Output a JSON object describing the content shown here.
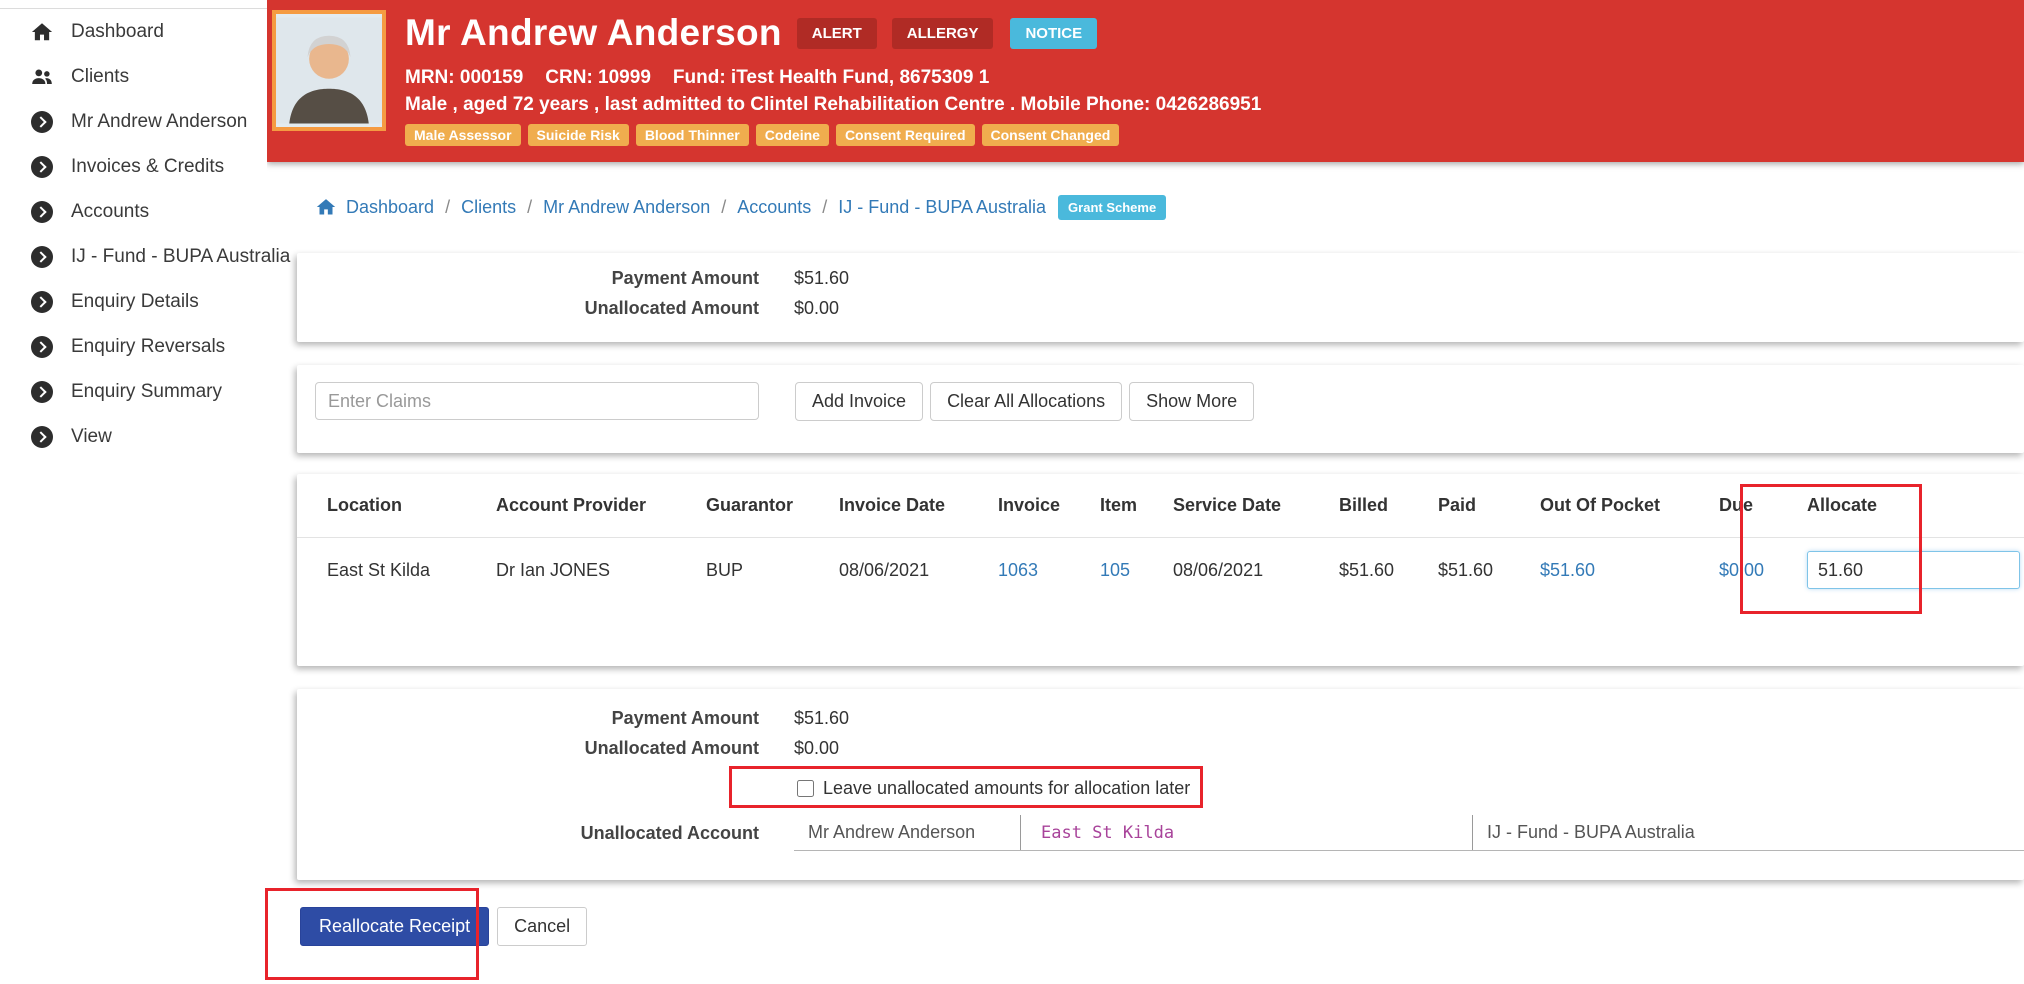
{
  "colors": {
    "header_red": "#d5352f",
    "badge_dark_red": "#b02b25",
    "badge_cyan": "#4ab9dc",
    "tag_orange": "#f0ad4e",
    "link_blue": "#337ab7",
    "primary_blue": "#2e4ca5",
    "annotation_red": "#e8232b",
    "magenta": "#a8439a",
    "avatar_orange": "#f59b42"
  },
  "sidebar": {
    "items": [
      {
        "label": "Dashboard",
        "icon": "home-icon"
      },
      {
        "label": "Clients",
        "icon": "users-icon"
      },
      {
        "label": "Mr Andrew Anderson",
        "icon": "chevron-circle-icon"
      },
      {
        "label": "Invoices & Credits",
        "icon": "chevron-circle-icon"
      },
      {
        "label": "Accounts",
        "icon": "chevron-circle-icon"
      },
      {
        "label": "IJ - Fund - BUPA Australia",
        "icon": "chevron-circle-icon"
      },
      {
        "label": "Enquiry Details",
        "icon": "chevron-circle-icon"
      },
      {
        "label": "Enquiry Reversals",
        "icon": "chevron-circle-icon"
      },
      {
        "label": "Enquiry Summary",
        "icon": "chevron-circle-icon"
      },
      {
        "label": "View",
        "icon": "chevron-circle-icon"
      }
    ]
  },
  "header": {
    "patient_name": "Mr Andrew Anderson",
    "badges": [
      {
        "label": "ALERT"
      },
      {
        "label": "ALLERGY"
      },
      {
        "label": "NOTICE"
      }
    ],
    "identifier_parts": [
      "MRN: 000159",
      "CRN: 10999",
      "Fund: iTest Health Fund, 8675309 1"
    ],
    "demographics": "Male , aged 72 years , last admitted to Clintel Rehabilitation Centre . Mobile Phone: 0426286951",
    "alert_tags": [
      "Male Assessor",
      "Suicide Risk",
      "Blood Thinner",
      "Codeine",
      "Consent Required",
      "Consent Changed"
    ]
  },
  "breadcrumb": {
    "separator": "/",
    "items": [
      "Dashboard",
      "Clients",
      "Mr Andrew Anderson",
      "Accounts",
      "IJ - Fund - BUPA Australia"
    ],
    "badge": "Grant Scheme"
  },
  "payment_summary_top": {
    "payment_amount_label": "Payment Amount",
    "payment_amount": "$51.60",
    "unallocated_amount_label": "Unallocated Amount",
    "unallocated_amount": "$0.00"
  },
  "claims_toolbar": {
    "search_placeholder": "Enter Claims",
    "buttons": [
      "Add Invoice",
      "Clear All Allocations",
      "Show More"
    ]
  },
  "invoice_table": {
    "columns": [
      "Location",
      "Account Provider",
      "Guarantor",
      "Invoice Date",
      "Invoice",
      "Item",
      "Service Date",
      "Billed",
      "Paid",
      "Out Of Pocket",
      "Due",
      "Allocate"
    ],
    "rows": [
      {
        "location": "East St Kilda",
        "account_provider": "Dr Ian JONES",
        "guarantor": "BUP",
        "invoice_date": "08/06/2021",
        "invoice": "1063",
        "item": "105",
        "service_date": "08/06/2021",
        "billed": "$51.60",
        "paid": "$51.60",
        "out_of_pocket": "$51.60",
        "due": "$0.00",
        "allocate": "51.60"
      }
    ]
  },
  "payment_summary_bottom": {
    "payment_amount_label": "Payment Amount",
    "payment_amount": "$51.60",
    "unallocated_amount_label": "Unallocated Amount",
    "unallocated_amount": "$0.00",
    "checkbox_label": "Leave unallocated amounts for allocation later",
    "checkbox_checked": false,
    "unallocated_account_label": "Unallocated Account",
    "unallocated_account_segments": [
      "Mr Andrew Anderson",
      "East St Kilda",
      "IJ - Fund - BUPA Australia"
    ]
  },
  "actions": {
    "reallocate_label": "Reallocate Receipt",
    "cancel_label": "Cancel"
  }
}
